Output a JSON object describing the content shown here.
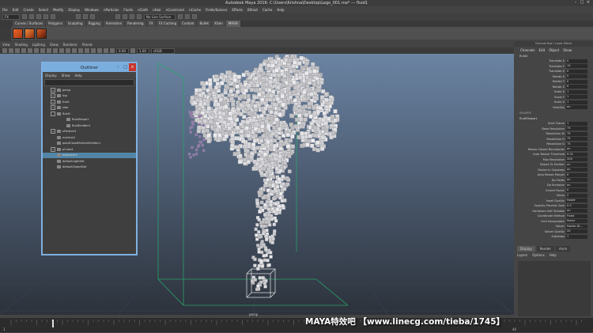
{
  "window": {
    "title": "Autodesk Maya 2016: C:\\Users\\Krishna\\Desktop\\Lego_001.ma* --- fluid1"
  },
  "menubar": [
    "File",
    "Edit",
    "Create",
    "Select",
    "Modify",
    "Display",
    "Windows",
    "nParticles",
    "Fluids",
    "nCloth",
    "nHair",
    "nConstraint",
    "nCache",
    "Fields/Solvers",
    "Effects",
    "Bifrost",
    "Cache",
    "Help"
  ],
  "status": {
    "mode": "FX",
    "surface_field": "No Live Surface"
  },
  "shelf": {
    "tabs": [
      "Curves / Surfaces",
      "Polygons",
      "Sculpting",
      "Rigging",
      "Animation",
      "Rendering",
      "FX",
      "FX Caching",
      "Custom",
      "Bullet",
      "XGen",
      "MASH"
    ],
    "active": 11
  },
  "viewport": {
    "menu": [
      "View",
      "Shading",
      "Lighting",
      "Show",
      "Renderer",
      "Panels"
    ],
    "exposure": "0.00",
    "gamma": "1.00",
    "colorspace": "sRGB gamma",
    "camera_label": "persp"
  },
  "outliner": {
    "title": "Outliner",
    "menu": [
      "Display",
      "Show",
      "Help"
    ],
    "items": [
      {
        "label": "persp",
        "depth": 0,
        "exp": "+"
      },
      {
        "label": "top",
        "depth": 0,
        "exp": "+"
      },
      {
        "label": "front",
        "depth": 0,
        "exp": "+"
      },
      {
        "label": "side",
        "depth": 0,
        "exp": "+"
      },
      {
        "label": "fluid1",
        "depth": 0,
        "exp": "-"
      },
      {
        "label": "fluidShape1",
        "depth": 1,
        "exp": ""
      },
      {
        "label": "fluidEmitter1",
        "depth": 1,
        "exp": ""
      },
      {
        "label": "nParticle1",
        "depth": 0,
        "exp": "+"
      },
      {
        "label": "nucleus1",
        "depth": 0,
        "exp": ""
      },
      {
        "label": "pointCloudParticleEmitter1",
        "depth": 0,
        "exp": ""
      },
      {
        "label": "pCube1",
        "depth": 0,
        "exp": "+"
      },
      {
        "label": "instancer1",
        "depth": 0,
        "exp": "",
        "selected": true
      },
      {
        "label": "defaultLightSet",
        "depth": 0,
        "exp": ""
      },
      {
        "label": "defaultObjectSet",
        "depth": 0,
        "exp": ""
      }
    ]
  },
  "channelbox": {
    "title": "Channel Box / Layer Editor",
    "menu": [
      "Channels",
      "Edit",
      "Object",
      "Show"
    ],
    "object": "fluid1",
    "transform": [
      {
        "label": "Translate X",
        "value": "0"
      },
      {
        "label": "Translate Y",
        "value": "10"
      },
      {
        "label": "Translate Z",
        "value": "0"
      },
      {
        "label": "Rotate X",
        "value": "0"
      },
      {
        "label": "Rotate Y",
        "value": "0"
      },
      {
        "label": "Rotate Z",
        "value": "0"
      },
      {
        "label": "Scale X",
        "value": "1"
      },
      {
        "label": "Scale Y",
        "value": "1"
      },
      {
        "label": "Scale Z",
        "value": "1"
      },
      {
        "label": "Visibility",
        "value": "on"
      }
    ],
    "shapes_header": "SHAPES",
    "shape_name": "fluidShape1",
    "shape_attrs": [
      {
        "label": "Start Frame",
        "value": "1"
      },
      {
        "label": "Base Resolution",
        "value": "75"
      },
      {
        "label": "Resolution W",
        "value": "75"
      },
      {
        "label": "Resolution H",
        "value": "75"
      },
      {
        "label": "Resolution D",
        "value": "75"
      },
      {
        "label": "Resize Closed Boundaries",
        "value": "on"
      },
      {
        "label": "Auto Resize Threshold",
        "value": "0.01"
      },
      {
        "label": "Max Resolution",
        "value": "200"
      },
      {
        "label": "Resize To Emitter",
        "value": "on"
      },
      {
        "label": "Resize In Substeps",
        "value": "on"
      },
      {
        "label": "Auto Resize Margin",
        "value": "0"
      },
      {
        "label": "Do Fields",
        "value": "on"
      },
      {
        "label": "Do Emission",
        "value": "on"
      },
      {
        "label": "Inherit Factor",
        "value": "0"
      },
      {
        "label": "Slices",
        "value": "2"
      },
      {
        "label": "Voxel Quality",
        "value": "Faster"
      },
      {
        "label": "Opacity Preview Gain",
        "value": "0.5"
      },
      {
        "label": "Hardware Self Shadow",
        "value": "on"
      },
      {
        "label": "Coordinate Method",
        "value": "Fixed"
      },
      {
        "label": "Grid Interpolator",
        "value": "linear"
      },
      {
        "label": "Solver",
        "value": "Navier-St..."
      },
      {
        "label": "Solver Quality",
        "value": "20"
      },
      {
        "label": "Substeps",
        "value": "1"
      }
    ]
  },
  "layers": {
    "tabs": [
      "Display",
      "Render",
      "Anim"
    ],
    "active": 0,
    "menu": [
      "Layers",
      "Options",
      "Help"
    ]
  },
  "timeline": {
    "start": "1",
    "current": "40"
  },
  "watermark": "MAYA特效吧  【www.linecg.com/tieba/1745】",
  "colors": {
    "outliner_title": "#79aede",
    "selection": "#5285a6",
    "close": "#c8352c",
    "container": "#2aa36a"
  }
}
